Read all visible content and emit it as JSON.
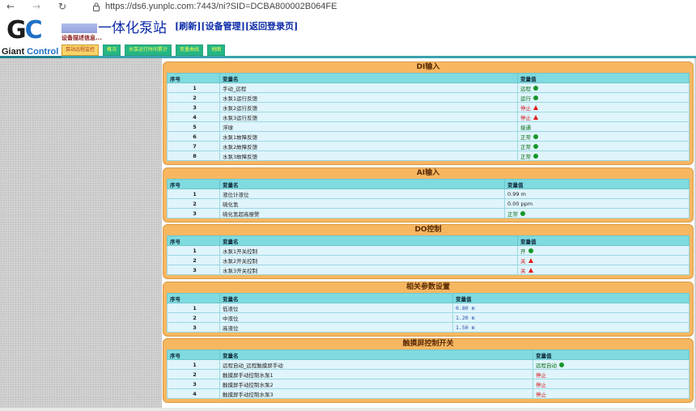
{
  "browser": {
    "url": "https://ds6.yunplc.com:7443/ni?SID=DCBA800002B064FE"
  },
  "logo": {
    "mark_left": "G",
    "mark_right": "C",
    "text_left": "Giant ",
    "text_right": "Control"
  },
  "header": {
    "title": "一体化泵站",
    "links": [
      "[刷新]",
      "[设备管理]",
      "[返回登录页]"
    ],
    "status": "设备描述信息..."
  },
  "tabs": [
    {
      "label": "泵站远程监控",
      "active": true
    },
    {
      "label": "概况"
    },
    {
      "label": "水泵运行时间累计"
    },
    {
      "label": "变量曲线"
    },
    {
      "label": "地图"
    }
  ],
  "panels": {
    "di": {
      "title": "DI输入",
      "headers": [
        "序号",
        "变量名",
        "变量值"
      ],
      "rows": [
        {
          "no": "1",
          "name": "手动_远程",
          "value": "远程",
          "mark": "dot",
          "color": "green"
        },
        {
          "no": "2",
          "name": "水泵1运行反馈",
          "value": "运行",
          "mark": "dot",
          "color": "green"
        },
        {
          "no": "3",
          "name": "水泵2运行反馈",
          "value": "停止",
          "mark": "tri",
          "color": "red"
        },
        {
          "no": "4",
          "name": "水泵3运行反馈",
          "value": "停止",
          "mark": "tri",
          "color": "red"
        },
        {
          "no": "5",
          "name": "浮球",
          "value": "接通",
          "mark": "",
          "color": "green"
        },
        {
          "no": "6",
          "name": "水泵1故障反馈",
          "value": "正常",
          "mark": "dot",
          "color": "green"
        },
        {
          "no": "7",
          "name": "水泵2故障反馈",
          "value": "正常",
          "mark": "dot",
          "color": "green"
        },
        {
          "no": "8",
          "name": "水泵3故障反馈",
          "value": "正常",
          "mark": "dot",
          "color": "green"
        }
      ]
    },
    "ai": {
      "title": "AI输入",
      "headers": [
        "序号",
        "变量名",
        "变量值"
      ],
      "rows": [
        {
          "no": "1",
          "name": "液位计液位",
          "value": "0.99 m",
          "mark": "",
          "color": "plain"
        },
        {
          "no": "2",
          "name": "硫化氢",
          "value": "0.00 ppm",
          "mark": "",
          "color": "plain"
        },
        {
          "no": "3",
          "name": "硫化氢超高报警",
          "value": "正常",
          "mark": "dot",
          "color": "green"
        }
      ]
    },
    "do": {
      "title": "DO控制",
      "headers": [
        "序号",
        "变量名",
        "变量值"
      ],
      "rows": [
        {
          "no": "1",
          "name": "水泵1开关控制",
          "value": "开",
          "mark": "dot",
          "color": "green"
        },
        {
          "no": "2",
          "name": "水泵2开关控制",
          "value": "关",
          "mark": "tri",
          "color": "red"
        },
        {
          "no": "3",
          "name": "水泵3开关控制",
          "value": "关",
          "mark": "tri",
          "color": "red"
        }
      ]
    },
    "params": {
      "title": "相关参数设置",
      "headers": [
        "序号",
        "变量名",
        "变量值"
      ],
      "rows": [
        {
          "no": "1",
          "name": "低液位",
          "value": "0.80 m",
          "mark": "",
          "color": "blue"
        },
        {
          "no": "2",
          "name": "中液位",
          "value": "1.20 m",
          "mark": "",
          "color": "blue"
        },
        {
          "no": "3",
          "name": "高液位",
          "value": "1.50 m",
          "mark": "",
          "color": "blue"
        }
      ]
    },
    "touch": {
      "title": "触摸屏控制开关",
      "headers": [
        "序号",
        "变量名",
        "变量值"
      ],
      "rows": [
        {
          "no": "1",
          "name": "远程自动_远程触摸屏手动",
          "value": "远程自动",
          "mark": "dot",
          "color": "green"
        },
        {
          "no": "2",
          "name": "触摸屏手动控制水泵1",
          "value": "停止",
          "mark": "",
          "color": "red"
        },
        {
          "no": "3",
          "name": "触摸屏手动控制水泵2",
          "value": "停止",
          "mark": "",
          "color": "red"
        },
        {
          "no": "4",
          "name": "触摸屏手动控制水泵3",
          "value": "停止",
          "mark": "",
          "color": "red"
        }
      ]
    }
  },
  "colors": {
    "panel_bg": "#f7b761",
    "header_cell": "#7fdbe0",
    "row_bg": "#dff4fb",
    "ok_green": "#17962a",
    "alarm_red": "#e01e1e",
    "title_blue": "#0d2ca8"
  }
}
